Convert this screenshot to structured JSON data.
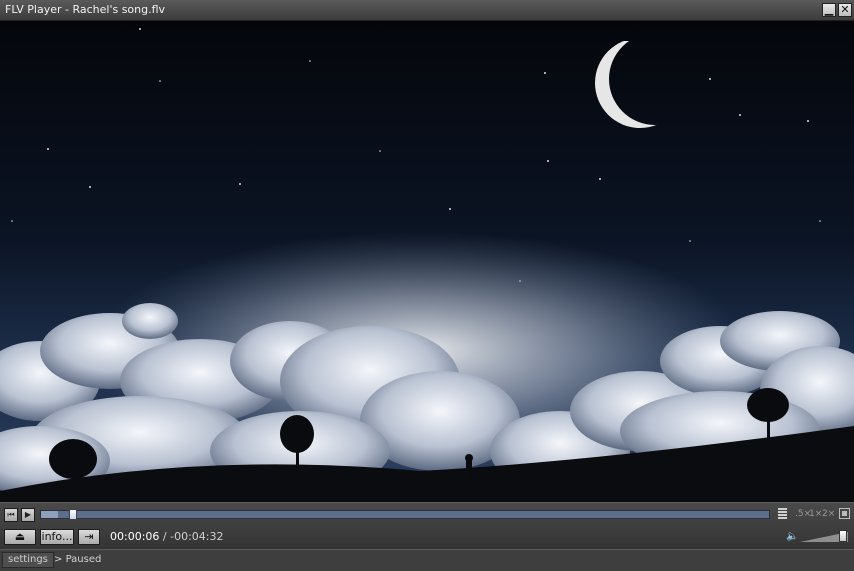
{
  "window": {
    "title": "FLV Player - Rachel's song.flv",
    "minimize_symbol": "▁",
    "close_symbol": "✕"
  },
  "controls": {
    "prev_icon": "prev-frame-icon",
    "play_icon": "play-icon",
    "seek_progress": 0.023,
    "speed_options": [
      ".5×",
      "1×",
      "2×"
    ],
    "eject_icon": "eject-icon",
    "info_label": "info...",
    "jump_icon": "jump-to-end-icon",
    "time_current": "00:00:06",
    "time_separator": " / ",
    "time_remaining": "-00:04:32",
    "volume_level": 0.9
  },
  "status": {
    "settings_label": "settings",
    "state_text": "Paused",
    "state_icon": "chevron-right-icon"
  },
  "colors": {
    "seek_track": "#5d6e8a",
    "sky_top": "#05070c",
    "sky_bottom": "#1a2a44"
  }
}
